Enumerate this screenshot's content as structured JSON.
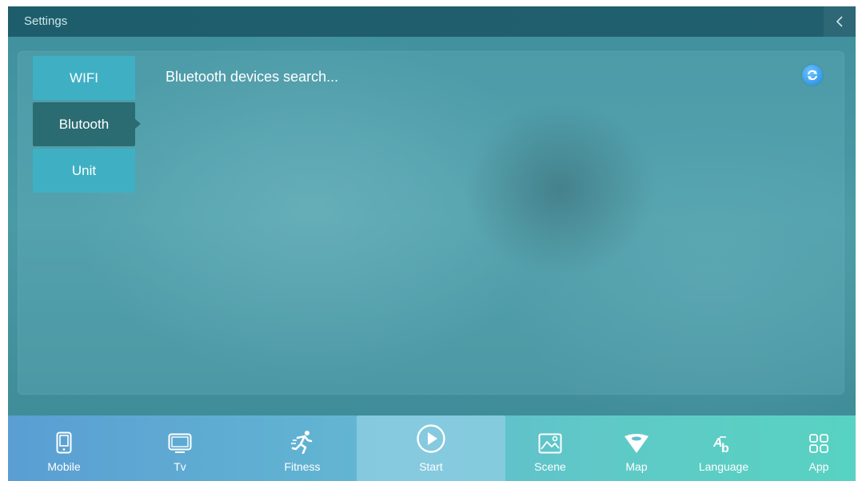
{
  "header": {
    "title": "Settings"
  },
  "menu": {
    "items": [
      {
        "label": "WIFI"
      },
      {
        "label": "Blutooth",
        "active": true
      },
      {
        "label": "Unit"
      }
    ]
  },
  "main": {
    "status": "Bluetooth devices search..."
  },
  "dock": {
    "items": [
      {
        "label": "Mobile",
        "icon": "tablet-icon"
      },
      {
        "label": "Tv",
        "icon": "tv-icon"
      },
      {
        "label": "Fitness",
        "icon": "runner-icon"
      },
      {
        "label": "Start",
        "icon": "play-circle-icon",
        "active": true
      },
      {
        "label": "Scene",
        "icon": "image-icon"
      },
      {
        "label": "Map",
        "icon": "map-pin-icon"
      },
      {
        "label": "Language",
        "icon": "language-icon"
      },
      {
        "label": "App",
        "icon": "apps-grid-icon"
      }
    ]
  },
  "colors": {
    "titlebar": "#1e5e6c",
    "menu_item": "#3fb0c4",
    "menu_item_active": "#2a6c72",
    "refresh_button": "#1e86e0"
  }
}
